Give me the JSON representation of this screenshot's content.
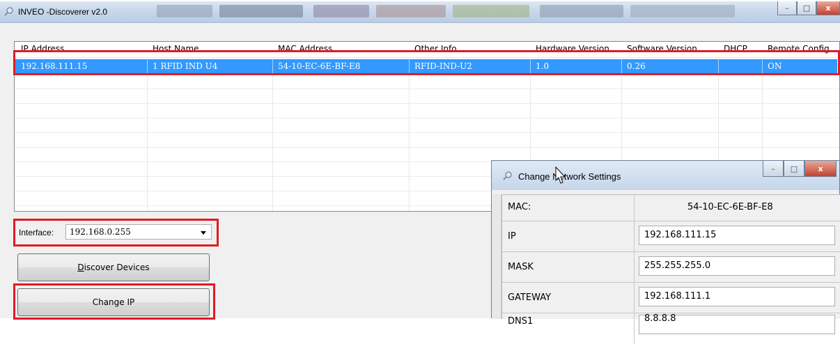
{
  "window": {
    "title": "INVEO -Discoverer v2.0",
    "min_label": "–",
    "max_label": "□",
    "close_label": "x"
  },
  "table": {
    "columns": [
      "IP Address",
      "Host Name",
      "MAC Address",
      "Other Info",
      "Hardware Version",
      "Software Version",
      "DHCP",
      "Remote Config"
    ],
    "rows": [
      {
        "ip": "192.168.111.15",
        "host": "1 RFID IND U4",
        "mac": "54-10-EC-6E-BF-E8",
        "other": "RFID-IND-U2",
        "hw": "1.0",
        "sw": "0.26",
        "dhcp": "",
        "remote": "ON"
      }
    ]
  },
  "interface": {
    "label": "Interface:",
    "value": "192.168.0.255"
  },
  "buttons": {
    "discover": "Discover Devices",
    "discover_accel": "D",
    "discover_rest": "iscover Devices",
    "change_ip": "Change IP"
  },
  "dialog": {
    "title": "Change Network Settings",
    "mac_label": "MAC:",
    "mac_value": "54-10-EC-6E-BF-E8",
    "ip_label": "IP",
    "ip_value": "192.168.111.15",
    "mask_label": "MASK",
    "mask_value": "255.255.255.0",
    "gateway_label": "GATEWAY",
    "gateway_value": "192.168.111.1",
    "dns1_label": "DNS1",
    "dns1_value": "8.8.8.8",
    "close_label": "x"
  },
  "colors": {
    "selection": "#3399ff",
    "highlight": "#e01b25",
    "titlebar": "#c8d8ea"
  }
}
